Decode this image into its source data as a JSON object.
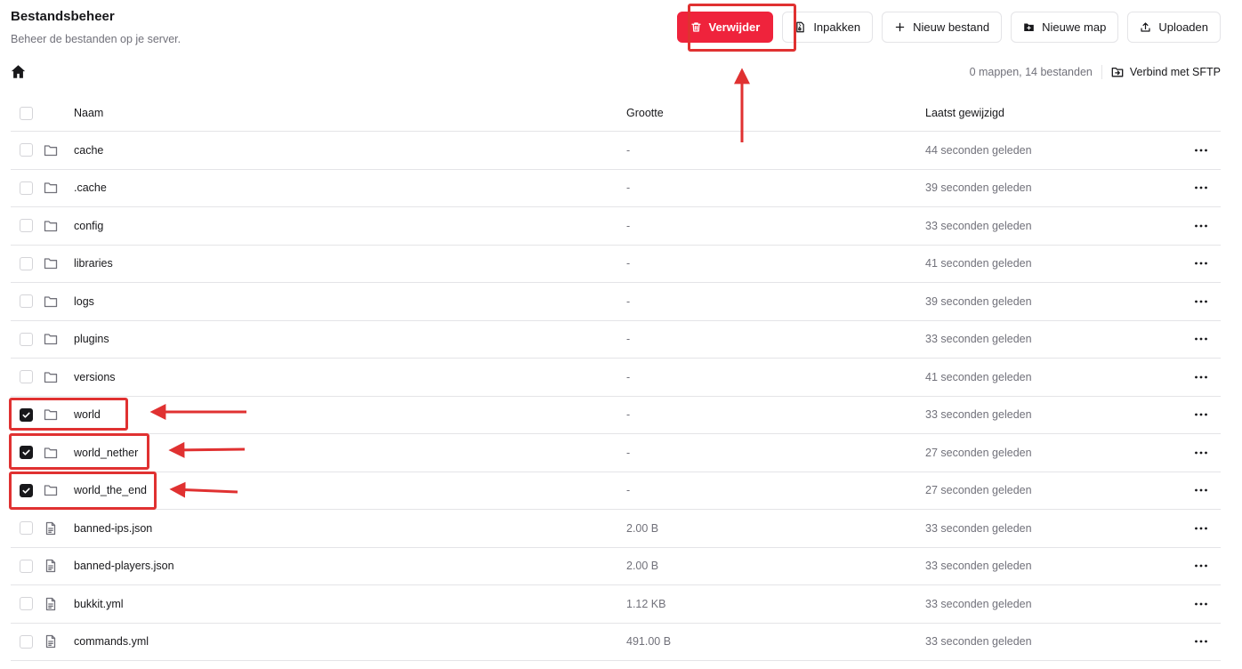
{
  "header": {
    "title": "Bestandsbeheer",
    "subtitle": "Beheer de bestanden op je server."
  },
  "toolbar": {
    "delete_label": "Verwijder",
    "pack_label": "Inpakken",
    "new_file_label": "Nieuw bestand",
    "new_folder_label": "Nieuwe map",
    "upload_label": "Uploaden"
  },
  "meta": {
    "count": "0 mappen, 14 bestanden",
    "sftp_label": "Verbind met SFTP"
  },
  "columns": {
    "name": "Naam",
    "size": "Grootte",
    "modified": "Laatst gewijzigd"
  },
  "colors": {
    "danger": "#ef233c",
    "annotation": "#e03131"
  },
  "rows": [
    {
      "name": "cache",
      "icon": "folder-icon",
      "size": "-",
      "modified": "44 seconden geleden",
      "checked": false
    },
    {
      "name": ".cache",
      "icon": "folder-icon",
      "size": "-",
      "modified": "39 seconden geleden",
      "checked": false
    },
    {
      "name": "config",
      "icon": "folder-icon",
      "size": "-",
      "modified": "33 seconden geleden",
      "checked": false
    },
    {
      "name": "libraries",
      "icon": "folder-icon",
      "size": "-",
      "modified": "41 seconden geleden",
      "checked": false
    },
    {
      "name": "logs",
      "icon": "folder-icon",
      "size": "-",
      "modified": "39 seconden geleden",
      "checked": false
    },
    {
      "name": "plugins",
      "icon": "folder-icon",
      "size": "-",
      "modified": "33 seconden geleden",
      "checked": false
    },
    {
      "name": "versions",
      "icon": "folder-icon",
      "size": "-",
      "modified": "41 seconden geleden",
      "checked": false
    },
    {
      "name": "world",
      "icon": "folder-icon",
      "size": "-",
      "modified": "33 seconden geleden",
      "checked": true
    },
    {
      "name": "world_nether",
      "icon": "folder-icon",
      "size": "-",
      "modified": "27 seconden geleden",
      "checked": true
    },
    {
      "name": "world_the_end",
      "icon": "folder-icon",
      "size": "-",
      "modified": "27 seconden geleden",
      "checked": true
    },
    {
      "name": "banned-ips.json",
      "icon": "file-icon",
      "size": "2.00 B",
      "modified": "33 seconden geleden",
      "checked": false
    },
    {
      "name": "banned-players.json",
      "icon": "file-icon",
      "size": "2.00 B",
      "modified": "33 seconden geleden",
      "checked": false
    },
    {
      "name": "bukkit.yml",
      "icon": "file-icon",
      "size": "1.12 KB",
      "modified": "33 seconden geleden",
      "checked": false
    },
    {
      "name": "commands.yml",
      "icon": "file-icon",
      "size": "491.00 B",
      "modified": "33 seconden geleden",
      "checked": false
    }
  ]
}
